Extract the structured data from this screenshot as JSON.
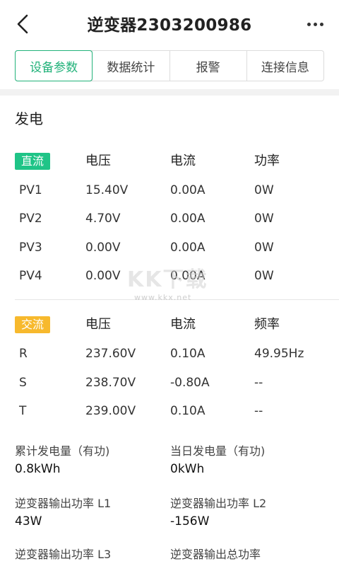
{
  "header": {
    "title": "逆变器2303200986",
    "back_icon": "chevron-left-icon",
    "more_icon": "more-horizontal-icon"
  },
  "tabs": [
    {
      "label": "设备参数",
      "active": true
    },
    {
      "label": "数据统计",
      "active": false
    },
    {
      "label": "报警",
      "active": false
    },
    {
      "label": "连接信息",
      "active": false
    }
  ],
  "generation": {
    "title": "发电",
    "dc": {
      "badge": "直流",
      "headers": [
        "电压",
        "电流",
        "功率"
      ],
      "rows": [
        {
          "name": "PV1",
          "voltage": "15.40V",
          "current": "0.00A",
          "power": "0W"
        },
        {
          "name": "PV2",
          "voltage": "4.70V",
          "current": "0.00A",
          "power": "0W"
        },
        {
          "name": "PV3",
          "voltage": "0.00V",
          "current": "0.00A",
          "power": "0W"
        },
        {
          "name": "PV4",
          "voltage": "0.00V",
          "current": "0.00A",
          "power": "0W"
        }
      ]
    },
    "ac": {
      "badge": "交流",
      "headers": [
        "电压",
        "电流",
        "频率"
      ],
      "rows": [
        {
          "name": "R",
          "voltage": "237.60V",
          "current": "0.10A",
          "frequency": "49.95Hz"
        },
        {
          "name": "S",
          "voltage": "238.70V",
          "current": "-0.80A",
          "frequency": "--"
        },
        {
          "name": "T",
          "voltage": "239.00V",
          "current": "0.10A",
          "frequency": "--"
        }
      ]
    }
  },
  "stats": [
    {
      "label": "累计发电量（有功)",
      "value": "0.8kWh"
    },
    {
      "label": "当日发电量（有功)",
      "value": "0kWh"
    },
    {
      "label": "逆变器输出功率 L1",
      "value": "43W"
    },
    {
      "label": "逆变器输出功率 L2",
      "value": "-156W"
    },
    {
      "label": "逆变器输出功率 L3",
      "value": ""
    },
    {
      "label": "逆变器输出总功率",
      "value": ""
    }
  ],
  "watermark": {
    "logo_text": "KK下载",
    "url": "www.kkx.net"
  },
  "colors": {
    "accent_green": "#22b27a",
    "dc_badge": "#1fc487",
    "ac_badge": "#f7b92d"
  }
}
